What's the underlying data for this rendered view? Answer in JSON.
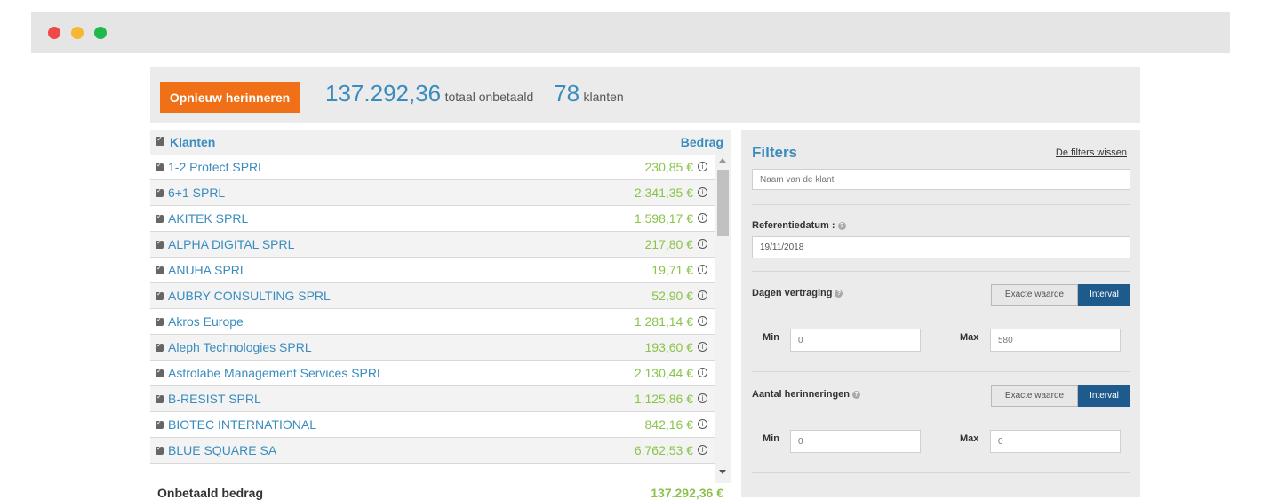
{
  "window": {
    "controls": [
      "close",
      "minimize",
      "maximize"
    ],
    "colors": {
      "close": "#f04848",
      "minimize": "#f7b733",
      "maximize": "#1fb84b"
    }
  },
  "topbar": {
    "button_label": "Opnieuw herinneren",
    "total_amount": "137.292,36",
    "total_label": "totaal onbetaald",
    "client_count": "78",
    "client_label": "klanten"
  },
  "client_list": {
    "header": {
      "label": "Klanten",
      "amount_label": "Bedrag"
    },
    "rows": [
      {
        "name": "1-2 Protect SPRL",
        "amount": "230,85 €"
      },
      {
        "name": "6+1 SPRL",
        "amount": "2.341,35 €"
      },
      {
        "name": "AKITEK SPRL",
        "amount": "1.598,17 €"
      },
      {
        "name": "ALPHA DIGITAL SPRL",
        "amount": "217,80 €"
      },
      {
        "name": "ANUHA SPRL",
        "amount": "19,71 €"
      },
      {
        "name": "AUBRY CONSULTING SPRL",
        "amount": "52,90 €"
      },
      {
        "name": "Akros Europe",
        "amount": "1.281,14 €"
      },
      {
        "name": "Aleph Technologies SPRL",
        "amount": "193,60 €"
      },
      {
        "name": "Astrolabe Management Services SPRL",
        "amount": "2.130,44 €"
      },
      {
        "name": "B-RESIST SPRL",
        "amount": "1.125,86 €"
      },
      {
        "name": "BIOTEC INTERNATIONAL",
        "amount": "842,16 €"
      },
      {
        "name": "BLUE SQUARE SA",
        "amount": "6.762,53 €"
      }
    ],
    "footer": {
      "label": "Onbetaald bedrag",
      "amount": "137.292,36 €"
    }
  },
  "filters": {
    "title": "Filters",
    "clear_label": "De filters wissen",
    "client_name_placeholder": "Naam van de klant",
    "reference_date_label": "Referentiedatum :",
    "reference_date_value": "19/11/2018",
    "days_late": {
      "label": "Dagen vertraging",
      "exact_label": "Exacte waarde",
      "interval_label": "Interval",
      "selected": "Interval",
      "min_label": "Min",
      "min_placeholder": "0",
      "max_label": "Max",
      "max_placeholder": "580"
    },
    "reminders": {
      "label": "Aantal herinneringen",
      "exact_label": "Exacte waarde",
      "interval_label": "Interval",
      "selected": "Interval",
      "min_label": "Min",
      "min_placeholder": "0",
      "max_label": "Max",
      "max_placeholder": "0"
    }
  },
  "colors": {
    "accent_blue": "#3a8cbf",
    "amount_green": "#8bc34a",
    "button_orange": "#f07018",
    "active_segment": "#1e5a8c"
  }
}
